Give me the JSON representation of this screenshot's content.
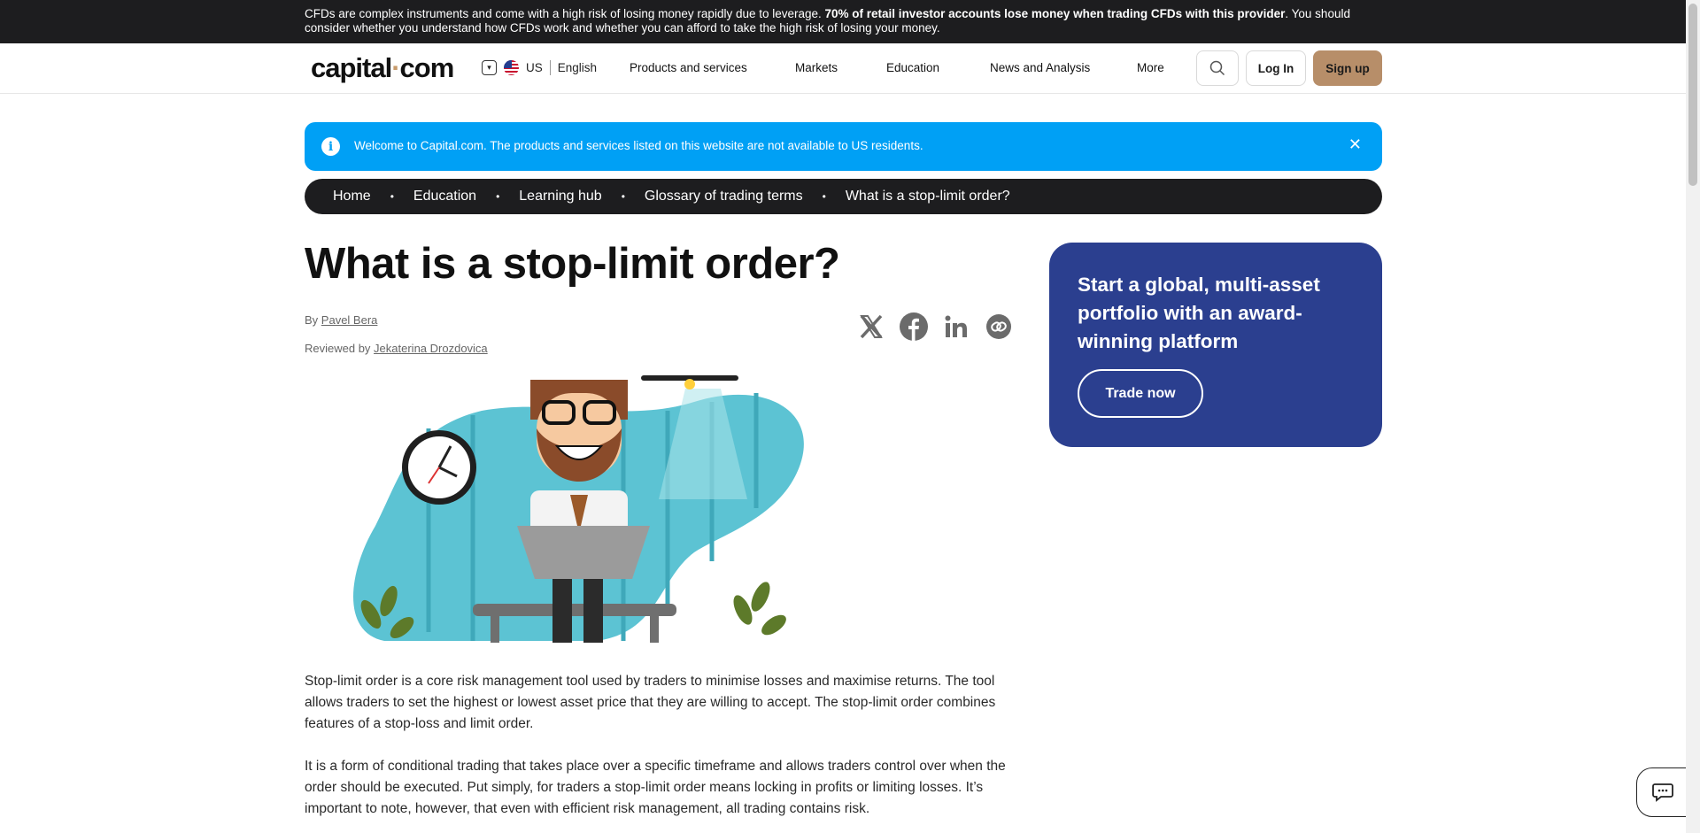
{
  "risk_warning": {
    "prefix": "CFDs are complex instruments and come with a high risk of losing money rapidly due to leverage. ",
    "bold": "70% of retail investor accounts lose money when trading CFDs with this provider",
    "suffix": ". You should consider whether you understand how CFDs work and whether you can afford to take the high risk of losing your money."
  },
  "header": {
    "logo_left": "capital",
    "logo_dot": "·",
    "logo_right": "com",
    "region": "US",
    "language": "English",
    "nav": [
      "Products and services",
      "Markets",
      "Education",
      "News and Analysis",
      "More"
    ],
    "login": "Log In",
    "signup": "Sign up"
  },
  "banner": {
    "info_glyph": "i",
    "text": "Welcome to Capital.com. The products and services listed on this website are not available to US residents.",
    "close": "✕"
  },
  "breadcrumb": [
    "Home",
    "Education",
    "Learning hub",
    "Glossary of trading terms",
    "What is a stop-limit order?"
  ],
  "article": {
    "title": "What is a stop-limit order?",
    "by_label": "By ",
    "author": "Pavel Bera",
    "reviewed_label": "Reviewed by ",
    "reviewer": "Jekaterina Drozdovica",
    "paragraphs": [
      "Stop-limit order is a core risk management tool used by traders to minimise losses and maximise returns. The tool allows traders to set the highest or lowest asset price that they are willing to accept. The stop-limit order combines features of a stop-loss and limit order.",
      "It is a form of conditional trading that takes place over a specific timeframe and allows traders control over when the order should be executed. Put simply, for traders a stop-limit order means locking in profits or limiting losses. It’s important to note, however, that even with efficient risk management, all trading contains risk."
    ]
  },
  "promo": {
    "text": "Start a global, multi-asset portfolio with an award-winning platform",
    "button": "Trade now"
  },
  "icons": {
    "share": [
      "x-icon",
      "facebook-icon",
      "linkedin-icon",
      "copy-link-icon"
    ]
  },
  "colors": {
    "banner": "#00a0f5",
    "promo": "#2b3f8f",
    "signup": "#b78e69",
    "dark": "#1d1d1f"
  }
}
